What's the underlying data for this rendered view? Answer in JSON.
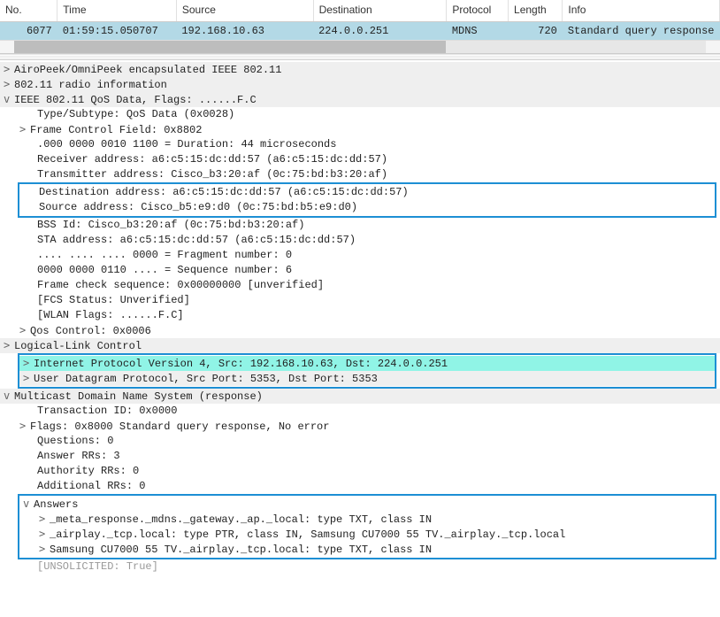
{
  "columns": {
    "no": "No.",
    "time": "Time",
    "source": "Source",
    "destination": "Destination",
    "protocol": "Protocol",
    "length": "Length",
    "info": "Info"
  },
  "packet": {
    "no": "6077",
    "time": "01:59:15.050707",
    "source": "192.168.10.63",
    "destination": "224.0.0.251",
    "protocol": "MDNS",
    "length": "720",
    "info": "Standard query response"
  },
  "tree": {
    "airopeek": "AiroPeek/OmniPeek encapsulated IEEE 802.11",
    "radio": "802.11 radio information",
    "ieee": "IEEE 802.11 QoS Data, Flags: ......F.C",
    "type_subtype": "Type/Subtype: QoS Data (0x0028)",
    "frame_control": "Frame Control Field: 0x8802",
    "duration": ".000 0000 0010 1100 = Duration: 44 microseconds",
    "receiver": "Receiver address: a6:c5:15:dc:dd:57 (a6:c5:15:dc:dd:57)",
    "transmitter": "Transmitter address: Cisco_b3:20:af (0c:75:bd:b3:20:af)",
    "destination_addr": "Destination address: a6:c5:15:dc:dd:57 (a6:c5:15:dc:dd:57)",
    "source_addr": "Source address: Cisco_b5:e9:d0 (0c:75:bd:b5:e9:d0)",
    "bss": "BSS Id: Cisco_b3:20:af (0c:75:bd:b3:20:af)",
    "sta": "STA address: a6:c5:15:dc:dd:57 (a6:c5:15:dc:dd:57)",
    "frag": ".... .... .... 0000 = Fragment number: 0",
    "seq": "0000 0000 0110 .... = Sequence number: 6",
    "fcs": "Frame check sequence: 0x00000000 [unverified]",
    "fcs_status": "[FCS Status: Unverified]",
    "wlan_flags": "[WLAN Flags: ......F.C]",
    "qos": "Qos Control: 0x0006",
    "llc": "Logical-Link Control",
    "ipv4": "Internet Protocol Version 4, Src: 192.168.10.63, Dst: 224.0.0.251",
    "udp": "User Datagram Protocol, Src Port: 5353, Dst Port: 5353",
    "mdns": "Multicast Domain Name System (response)",
    "txid": "Transaction ID: 0x0000",
    "flags": "Flags: 0x8000 Standard query response, No error",
    "questions": "Questions: 0",
    "answer_rrs": "Answer RRs: 3",
    "authority_rrs": "Authority RRs: 0",
    "additional_rrs": "Additional RRs: 0",
    "answers": "Answers",
    "ans1": "_meta_response._mdns._gateway._ap._local: type TXT, class IN",
    "ans2": "_airplay._tcp.local: type PTR, class IN, Samsung CU7000 55 TV._airplay._tcp.local",
    "ans3": "Samsung CU7000 55 TV._airplay._tcp.local: type TXT, class IN",
    "truncated": "[UNSOLICITED: True]"
  },
  "glyph": {
    "right": ">",
    "down": "v"
  }
}
